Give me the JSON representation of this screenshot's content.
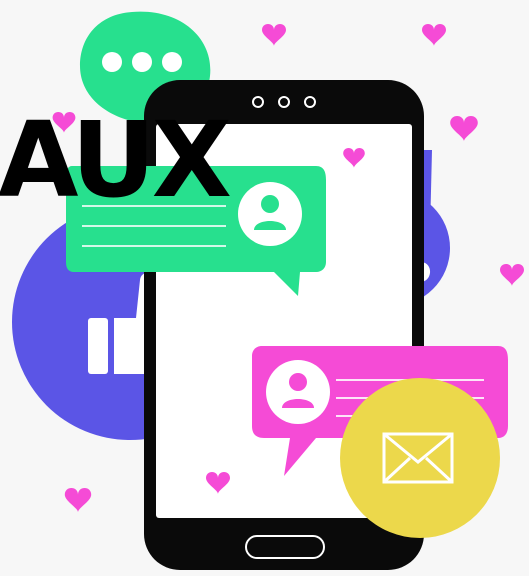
{
  "headline": "AUX",
  "phone": {
    "top_dots": "○ ○ ○"
  },
  "icons": {
    "typing_bubble": "chat-typing-icon",
    "thumbs_up": "thumbs-up-icon",
    "cloud": "cloud-icon",
    "envelope": "envelope-icon",
    "user": "user-icon",
    "heart": "heart-icon"
  },
  "colors": {
    "background": "#f7f7f7",
    "green": "#27e08e",
    "purple": "#5b55e6",
    "pink": "#f54bd6",
    "yellow": "#ecd84b",
    "heart": "#f54bd6",
    "phone": "#0a0a0a"
  }
}
